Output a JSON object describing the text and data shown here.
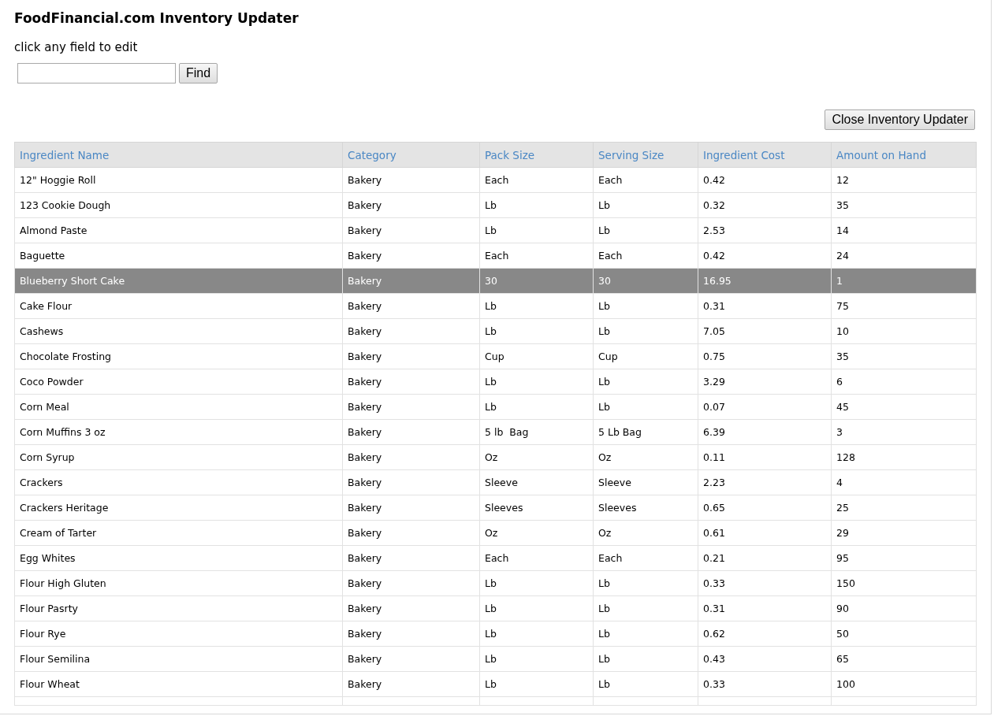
{
  "title": "FoodFinancial.com Inventory Updater",
  "instruction": "click any field to edit",
  "search": {
    "button": "Find"
  },
  "close_button": "Close Inventory Updater",
  "table": {
    "columns": [
      "Ingredient Name",
      "Category",
      "Pack Size",
      "Serving Size",
      "Ingredient Cost",
      "Amount on Hand"
    ],
    "rows": [
      {
        "cells": [
          "12\" Hoggie Roll",
          "Bakery",
          "Each",
          "Each",
          "0.42",
          "12"
        ],
        "selected": false
      },
      {
        "cells": [
          "123 Cookie Dough",
          "Bakery",
          "Lb",
          "Lb",
          "0.32",
          "35"
        ],
        "selected": false
      },
      {
        "cells": [
          "Almond Paste",
          "Bakery",
          "Lb",
          "Lb",
          "2.53",
          "14"
        ],
        "selected": false
      },
      {
        "cells": [
          "Baguette",
          "Bakery",
          "Each",
          "Each",
          "0.42",
          "24"
        ],
        "selected": false
      },
      {
        "cells": [
          "Blueberry Short Cake",
          "Bakery",
          "30",
          "30",
          "16.95",
          "1"
        ],
        "selected": true
      },
      {
        "cells": [
          "Cake Flour",
          "Bakery",
          "Lb",
          "Lb",
          "0.31",
          "75"
        ],
        "selected": false
      },
      {
        "cells": [
          "Cashews",
          "Bakery",
          "Lb",
          "Lb",
          "7.05",
          "10"
        ],
        "selected": false
      },
      {
        "cells": [
          "Chocolate Frosting",
          "Bakery",
          "Cup",
          "Cup",
          "0.75",
          "35"
        ],
        "selected": false
      },
      {
        "cells": [
          "Coco Powder",
          "Bakery",
          "Lb",
          "Lb",
          "3.29",
          "6"
        ],
        "selected": false
      },
      {
        "cells": [
          "Corn Meal",
          "Bakery",
          "Lb",
          "Lb",
          "0.07",
          "45"
        ],
        "selected": false
      },
      {
        "cells": [
          "Corn Muffins 3 oz",
          "Bakery",
          "5 lb  Bag",
          "5 Lb Bag",
          "6.39",
          "3"
        ],
        "selected": false
      },
      {
        "cells": [
          "Corn Syrup",
          "Bakery",
          "Oz",
          "Oz",
          "0.11",
          "128"
        ],
        "selected": false
      },
      {
        "cells": [
          "Crackers",
          "Bakery",
          "Sleeve",
          "Sleeve",
          "2.23",
          "4"
        ],
        "selected": false
      },
      {
        "cells": [
          "Crackers Heritage",
          "Bakery",
          "Sleeves",
          "Sleeves",
          "0.65",
          "25"
        ],
        "selected": false
      },
      {
        "cells": [
          "Cream of Tarter",
          "Bakery",
          "Oz",
          "Oz",
          "0.61",
          "29"
        ],
        "selected": false
      },
      {
        "cells": [
          "Egg Whites",
          "Bakery",
          "Each",
          "Each",
          "0.21",
          "95"
        ],
        "selected": false
      },
      {
        "cells": [
          "Flour High Gluten",
          "Bakery",
          "Lb",
          "Lb",
          "0.33",
          "150"
        ],
        "selected": false
      },
      {
        "cells": [
          "Flour Pasrty",
          "Bakery",
          "Lb",
          "Lb",
          "0.31",
          "90"
        ],
        "selected": false
      },
      {
        "cells": [
          "Flour Rye",
          "Bakery",
          "Lb",
          "Lb",
          "0.62",
          "50"
        ],
        "selected": false
      },
      {
        "cells": [
          "Flour Semilina",
          "Bakery",
          "Lb",
          "Lb",
          "0.43",
          "65"
        ],
        "selected": false
      },
      {
        "cells": [
          "Flour Wheat",
          "Bakery",
          "Lb",
          "Lb",
          "0.33",
          "100"
        ],
        "selected": false
      }
    ]
  }
}
